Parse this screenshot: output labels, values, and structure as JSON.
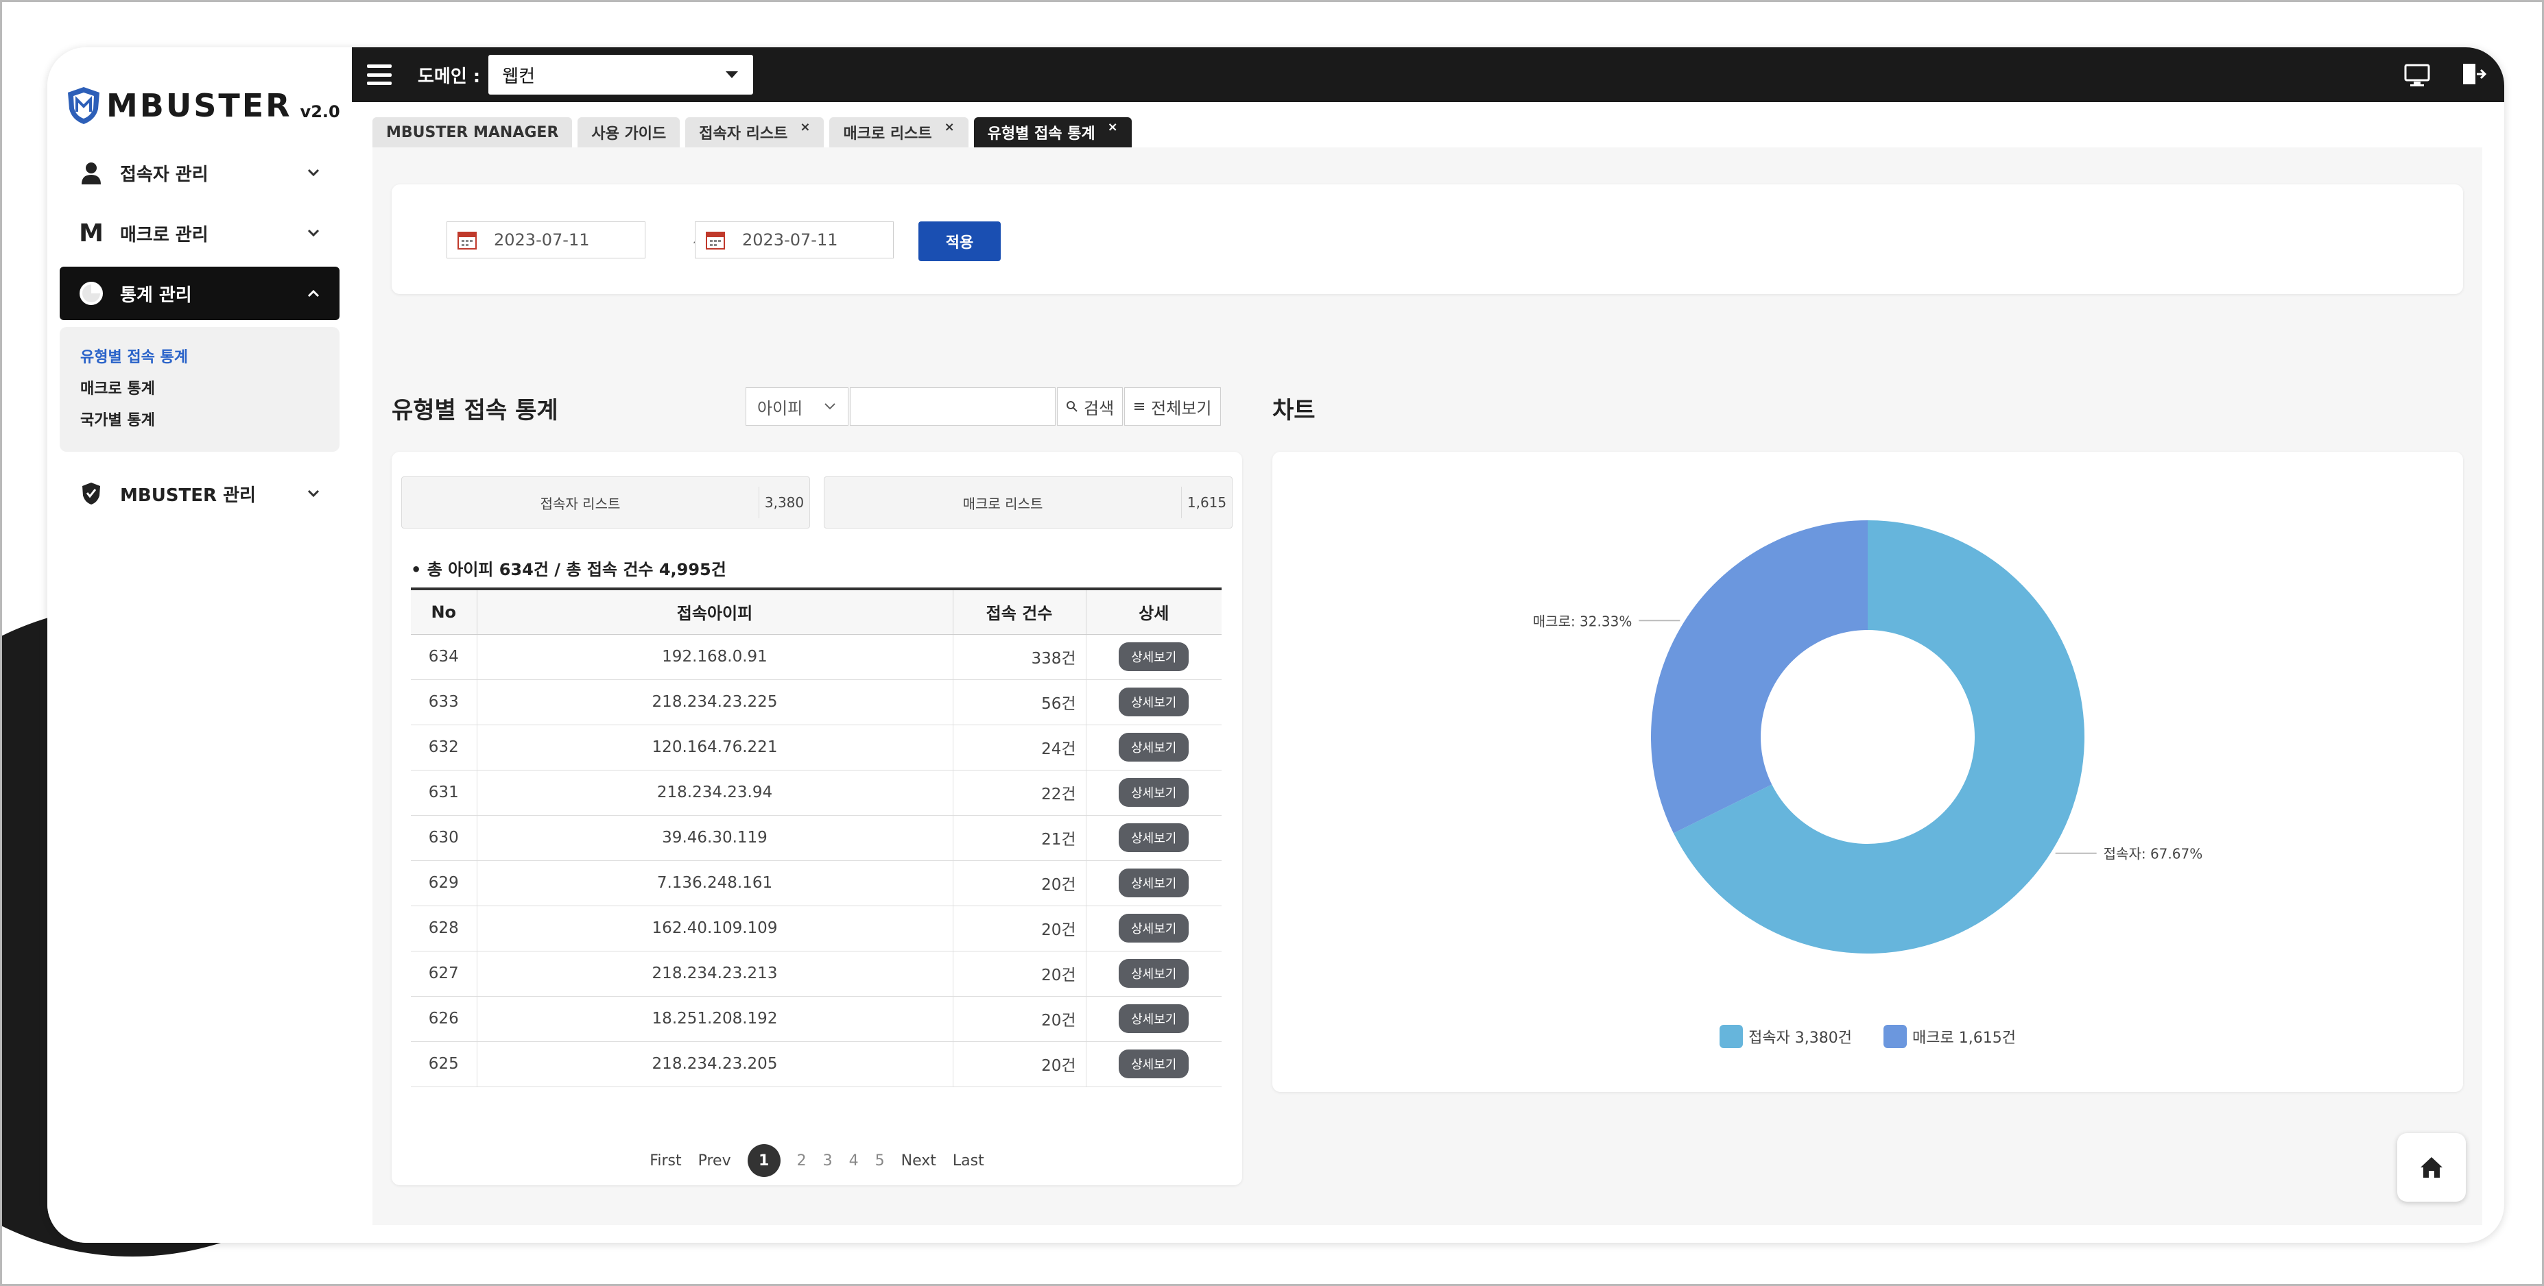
{
  "brand": {
    "name": "MBUSTER",
    "version": "v2.0"
  },
  "sidebar": {
    "items": [
      {
        "label": "접속자 관리",
        "icon": "user-icon"
      },
      {
        "label": "매크로 관리",
        "icon": "m-icon"
      },
      {
        "label": "통계 관리",
        "icon": "pie-icon",
        "active": true
      },
      {
        "label": "MBUSTER 관리",
        "icon": "shield-icon"
      }
    ],
    "submenu": [
      {
        "label": "유형별 접속 통계",
        "current": true
      },
      {
        "label": "매크로 통계"
      },
      {
        "label": "국가별 통계"
      }
    ]
  },
  "topbar": {
    "domain_label": "도메인 :",
    "domain_value": "웹컨"
  },
  "tabs": [
    {
      "label": "MBUSTER MANAGER",
      "closable": false
    },
    {
      "label": "사용 가이드",
      "closable": false
    },
    {
      "label": "접속자 리스트",
      "closable": true
    },
    {
      "label": "매크로 리스트",
      "closable": true
    },
    {
      "label": "유형별 접속 통계",
      "closable": true,
      "active": true
    }
  ],
  "filter": {
    "date_from": "2023-07-11",
    "tilde": "~",
    "date_to": "2023-07-11",
    "apply_label": "적용"
  },
  "list_section": {
    "title": "유형별 접속 통계",
    "search_select": "아이피",
    "search_btn": "검색",
    "view_all_btn": "전체보기"
  },
  "chart_section": {
    "title": "차트"
  },
  "stats": {
    "visitor_label": "접속자 리스트",
    "visitor_count": "3,380",
    "macro_label": "매크로 리스트",
    "macro_count": "1,615"
  },
  "summary": "• 총 아이피 634건 / 총 접속 건수 4,995건",
  "table": {
    "headers": [
      "No",
      "접속아이피",
      "접속 건수",
      "상세"
    ],
    "rows": [
      {
        "no": "634",
        "ip": "192.168.0.91",
        "count": "338건",
        "action": "상세보기"
      },
      {
        "no": "633",
        "ip": "218.234.23.225",
        "count": "56건",
        "action": "상세보기"
      },
      {
        "no": "632",
        "ip": "120.164.76.221",
        "count": "24건",
        "action": "상세보기"
      },
      {
        "no": "631",
        "ip": "218.234.23.94",
        "count": "22건",
        "action": "상세보기"
      },
      {
        "no": "630",
        "ip": "39.46.30.119",
        "count": "21건",
        "action": "상세보기"
      },
      {
        "no": "629",
        "ip": "7.136.248.161",
        "count": "20건",
        "action": "상세보기"
      },
      {
        "no": "628",
        "ip": "162.40.109.109",
        "count": "20건",
        "action": "상세보기"
      },
      {
        "no": "627",
        "ip": "218.234.23.213",
        "count": "20건",
        "action": "상세보기"
      },
      {
        "no": "626",
        "ip": "18.251.208.192",
        "count": "20건",
        "action": "상세보기"
      },
      {
        "no": "625",
        "ip": "218.234.23.205",
        "count": "20건",
        "action": "상세보기"
      }
    ]
  },
  "pagination": {
    "first": "First",
    "prev": "Prev",
    "pages": [
      "1",
      "2",
      "3",
      "4",
      "5"
    ],
    "current": "1",
    "next": "Next",
    "last": "Last"
  },
  "chart_data": {
    "type": "pie",
    "donut": true,
    "categories": [
      "접속자",
      "매크로"
    ],
    "values": [
      3380,
      1615
    ],
    "slice_labels": [
      "접속자: 67.67%",
      "매크로: 32.33%"
    ],
    "legend": [
      "접속자 3,380건",
      "매크로 1,615건"
    ],
    "colors": [
      "#66b5dc",
      "#6b97de"
    ],
    "legend_position": "bottom"
  },
  "colors": {
    "topbar": "#1a1a1a",
    "accent": "#1a4fb2",
    "active_menu": "#111111",
    "current_submenu": "#2a63c9"
  }
}
